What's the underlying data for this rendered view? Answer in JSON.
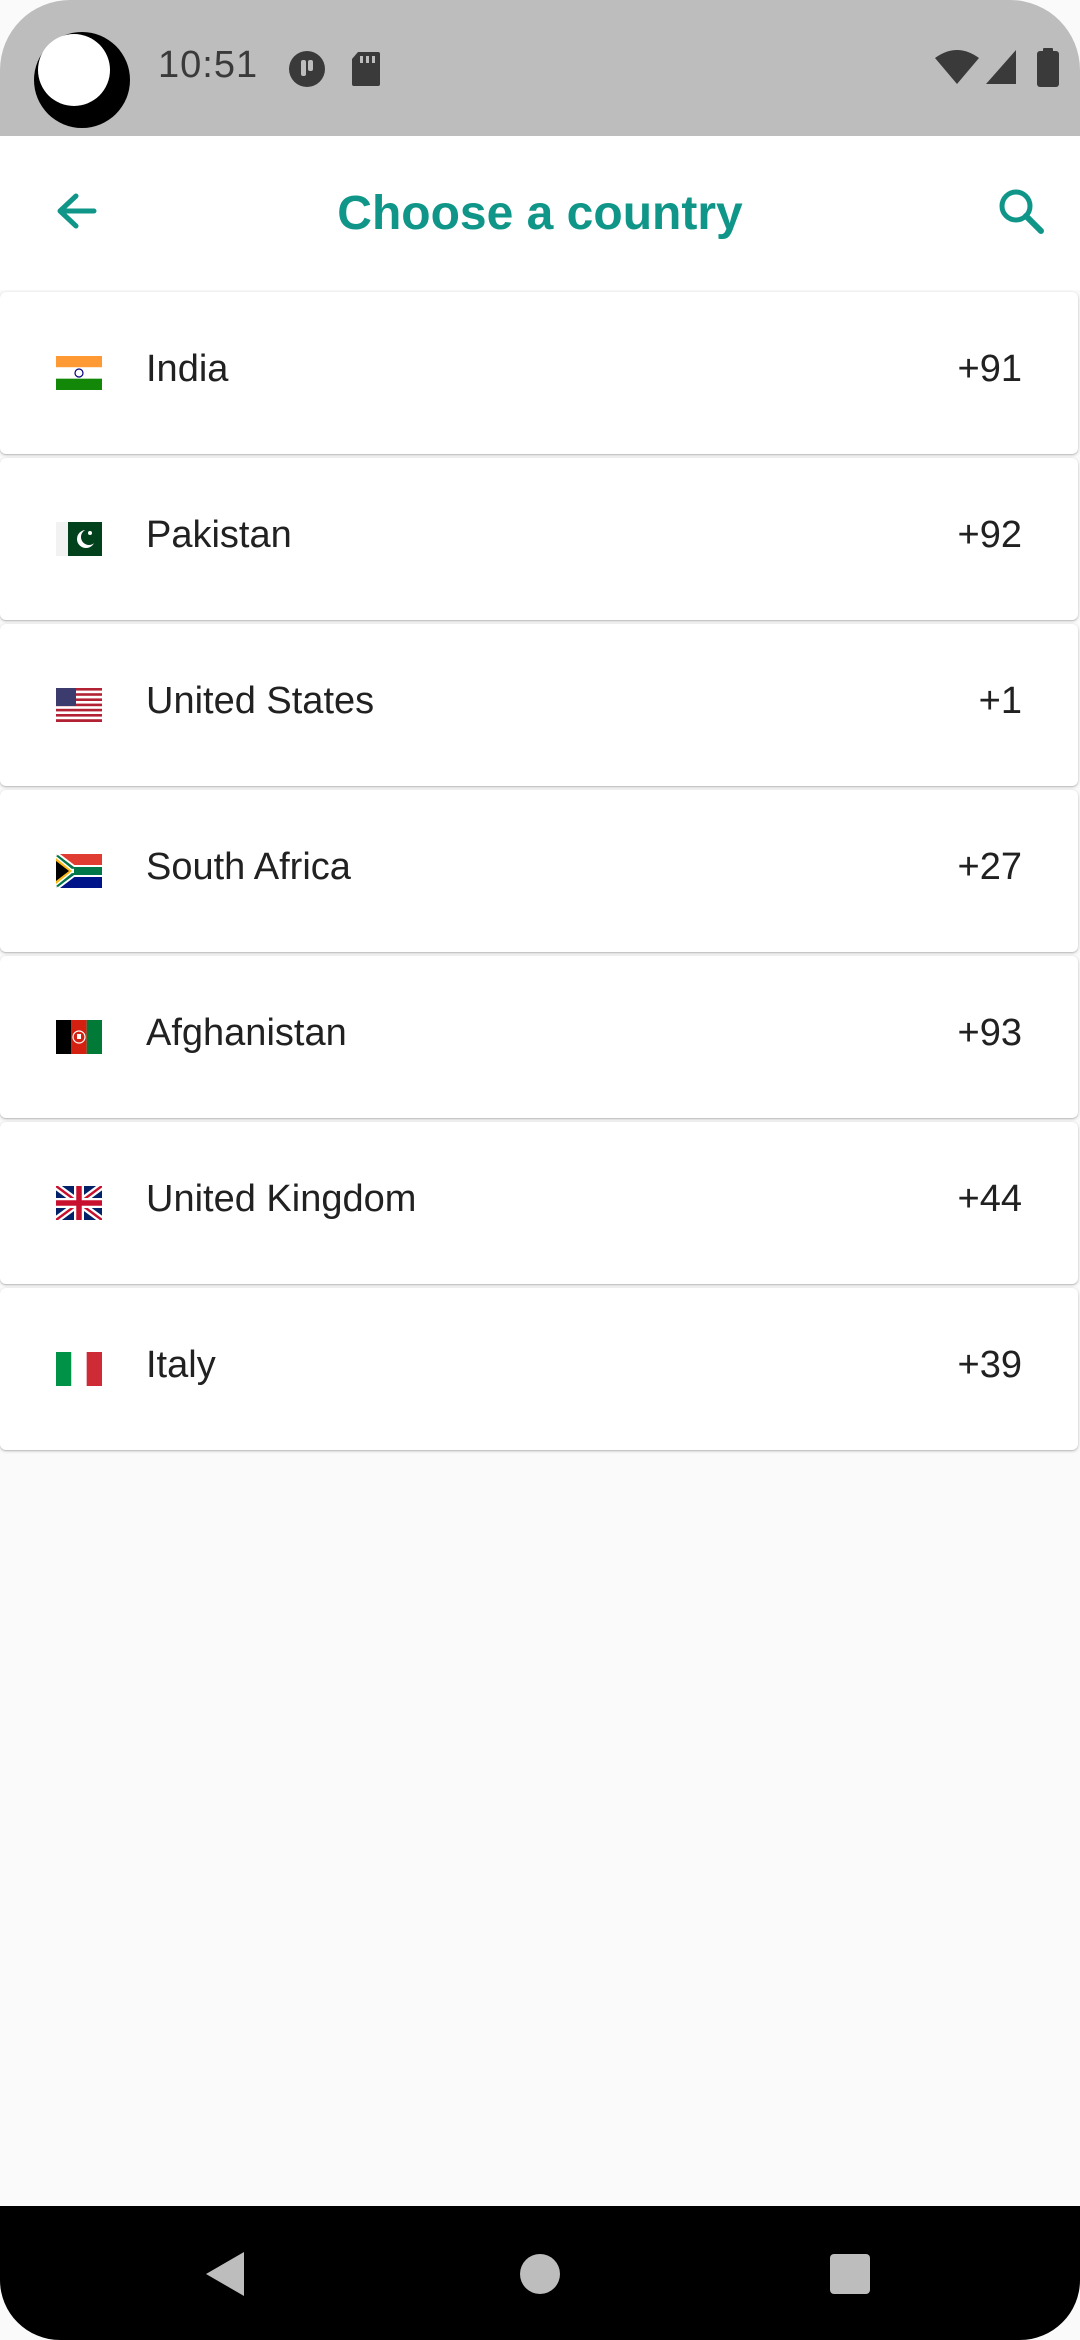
{
  "status_bar": {
    "time": "10:51",
    "icons": [
      "app-notification-icon",
      "sd-card-icon",
      "wifi-icon",
      "cellular-signal-icon",
      "battery-icon"
    ]
  },
  "app_bar": {
    "title": "Choose a country",
    "back_icon": "arrow-left-icon",
    "search_icon": "search-icon",
    "accent_color": "#0f9688"
  },
  "countries": [
    {
      "name": "India",
      "code": "+91",
      "flag": "flag-india-icon"
    },
    {
      "name": "Pakistan",
      "code": "+92",
      "flag": "flag-pakistan-icon"
    },
    {
      "name": "United States",
      "code": "+1",
      "flag": "flag-united-states-icon"
    },
    {
      "name": "South Africa",
      "code": "+27",
      "flag": "flag-south-africa-icon"
    },
    {
      "name": "Afghanistan",
      "code": "+93",
      "flag": "flag-afghanistan-icon"
    },
    {
      "name": "United Kingdom",
      "code": "+44",
      "flag": "flag-united-kingdom-icon"
    },
    {
      "name": "Italy",
      "code": "+39",
      "flag": "flag-italy-icon"
    }
  ],
  "nav_bar": {
    "icons": [
      "nav-back-icon",
      "nav-home-icon",
      "nav-recents-icon"
    ]
  }
}
